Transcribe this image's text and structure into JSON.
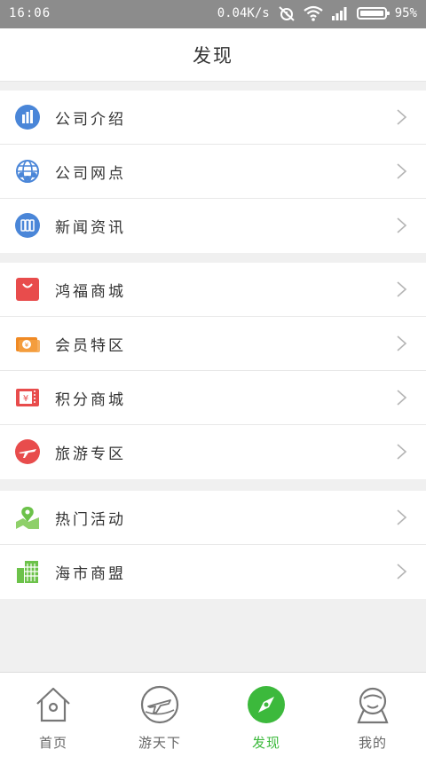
{
  "status_bar": {
    "time": "16:06",
    "network_speed": "0.04K/s",
    "battery_percent": "95%"
  },
  "header": {
    "title": "发现"
  },
  "groups": [
    {
      "items": [
        {
          "label": "公司介绍",
          "icon": "building-icon"
        },
        {
          "label": "公司网点",
          "icon": "network-globe-icon"
        },
        {
          "label": "新闻资讯",
          "icon": "news-icon"
        }
      ]
    },
    {
      "items": [
        {
          "label": "鸿福商城",
          "icon": "shopping-bag-icon"
        },
        {
          "label": "会员特区",
          "icon": "wallet-icon"
        },
        {
          "label": "积分商城",
          "icon": "coupon-icon"
        },
        {
          "label": "旅游专区",
          "icon": "airplane-icon"
        }
      ]
    },
    {
      "items": [
        {
          "label": "热门活动",
          "icon": "map-pin-icon"
        },
        {
          "label": "海市商盟",
          "icon": "buildings-icon"
        }
      ]
    }
  ],
  "tab_bar": {
    "tabs": [
      {
        "label": "首页",
        "icon": "home-icon",
        "active": false
      },
      {
        "label": "游天下",
        "icon": "plane-globe-icon",
        "active": false
      },
      {
        "label": "发现",
        "icon": "compass-icon",
        "active": true
      },
      {
        "label": "我的",
        "icon": "user-icon",
        "active": false
      }
    ]
  },
  "colors": {
    "accent_green": "#3cb93c",
    "blue_icon": "#4a86d8",
    "red_icon": "#e84c4c",
    "orange_icon": "#f08a24",
    "green_icon": "#6cc24a"
  }
}
